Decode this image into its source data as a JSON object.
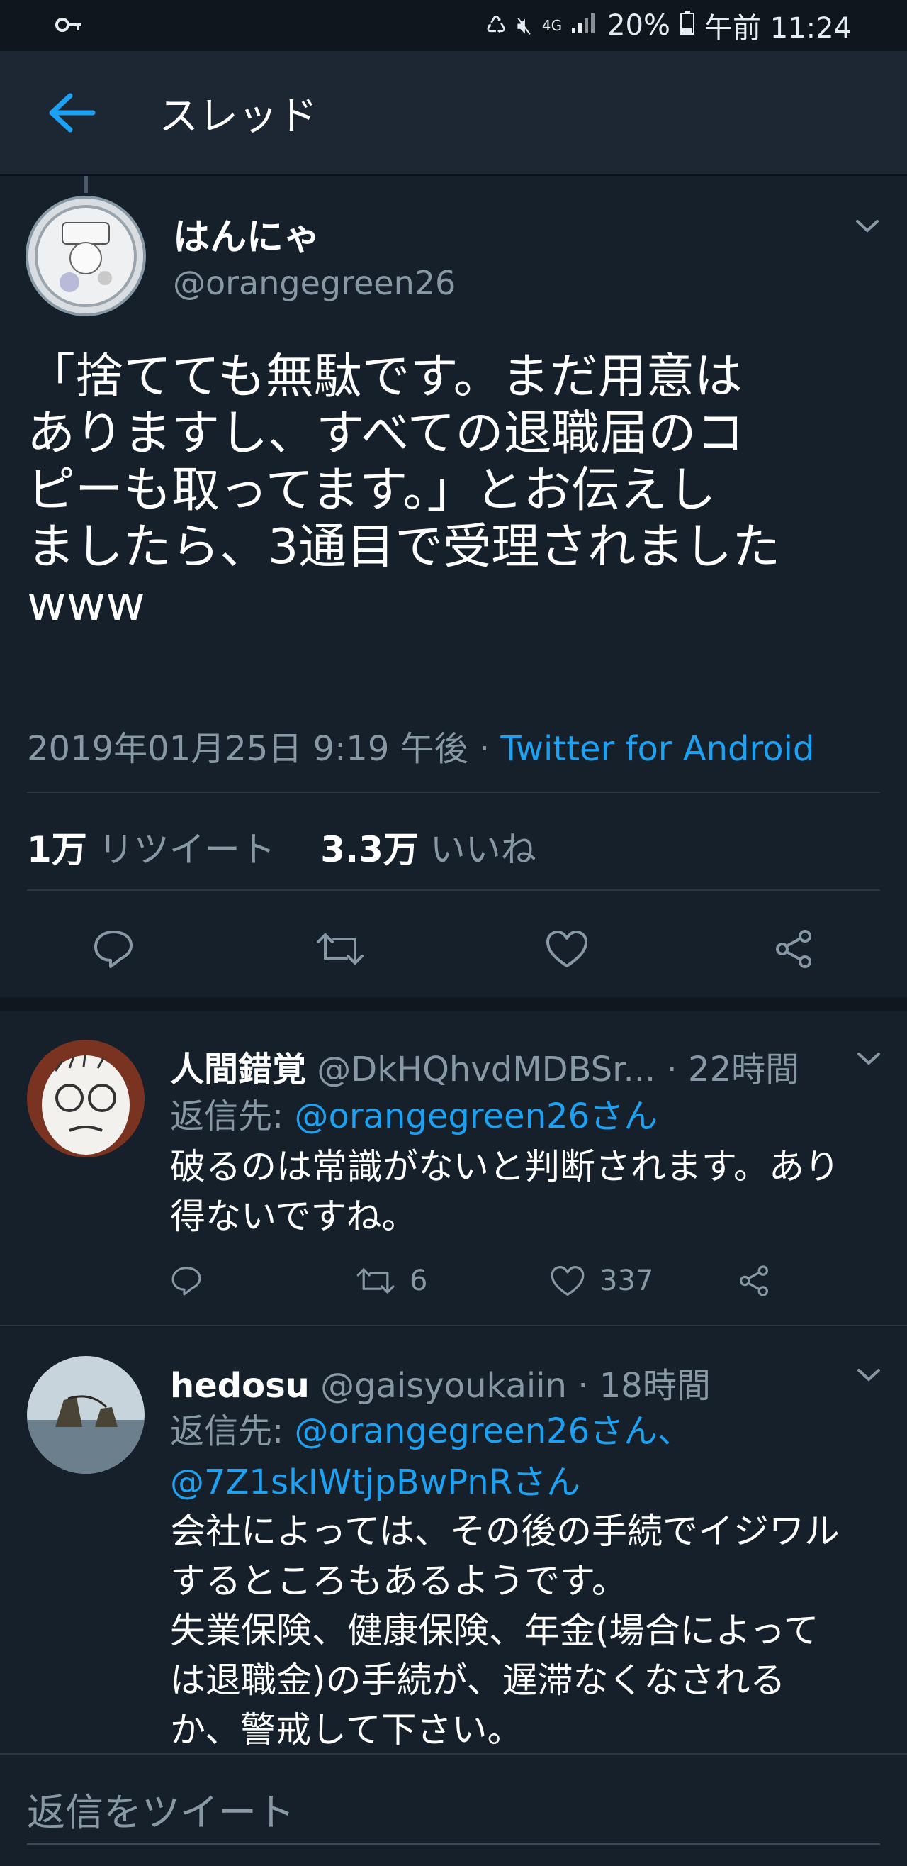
{
  "status_bar": {
    "battery": "20%",
    "time": "午前 11:24",
    "network": "4G"
  },
  "header": {
    "title": "スレッド"
  },
  "main_tweet": {
    "name": "はんにゃ",
    "handle": "@orangegreen26",
    "text": "「捨てても無駄です。まだ用意は\nありますし、すべての退職届のコ\nピーも取ってます。」とお伝えし\nましたら、3通目で受理されました\nwww",
    "timestamp": "2019年01月25日 9:19 午後 · ",
    "source": "Twitter for Android",
    "retweet_count": "1万",
    "retweet_label": "リツイート",
    "like_count": "3.3万",
    "like_label": "いいね"
  },
  "replies": [
    {
      "name": "人間錯覚",
      "handle": "@DkHQhvdMDBSr...",
      "time": "· 22時間",
      "reply_to_label": "返信先:",
      "mentions": "@orangegreen26さん",
      "text": "破るのは常識がないと判断されます。あり\n得ないですね。",
      "retweets": "6",
      "likes": "337"
    },
    {
      "name": "hedosu",
      "handle": "@gaisyoukaiin",
      "time": "· 18時間",
      "reply_to_label": "返信先:",
      "mentions_line1": "@orangegreen26さん、",
      "mentions_line2": "@7Z1skIWtjpBwPnRさん",
      "text": "会社によっては、その後の手続でイジワル\nするところもあるようです。\n失業保険、健康保険、年金(場合によって\nは退職金)の手続が、遅滞なくなされる\nか、警戒して下さい。"
    }
  ],
  "composer": {
    "placeholder": "返信をツイート"
  },
  "colors": {
    "accent": "#1da1f2",
    "background": "#15202b",
    "muted": "#8899a6"
  }
}
